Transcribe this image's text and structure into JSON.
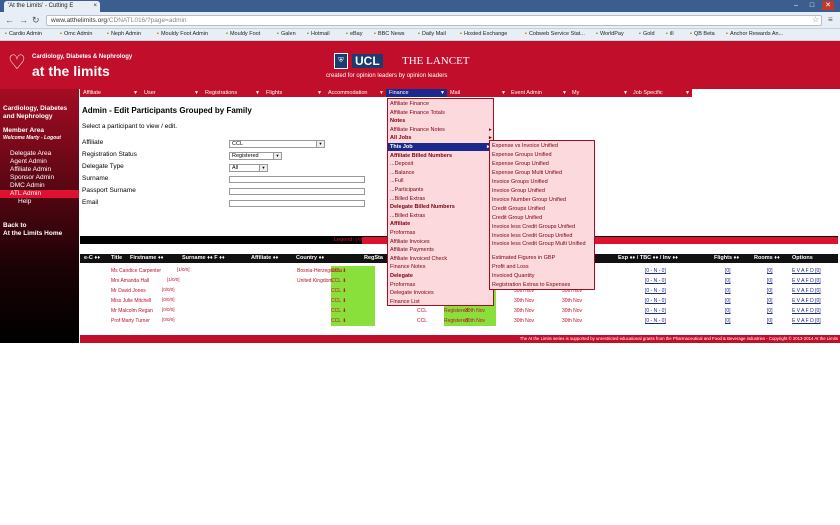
{
  "browser": {
    "tab_title": "'At the Limits' - Cutting E",
    "url_host": "www.atthelimits.org",
    "url_path": "/CDNATL016/?page=admin",
    "bookmarks": [
      "Cardio Admin",
      "Omc Admin",
      "Neph Admin",
      "Mouldy Foot Admin",
      "Mouldy Foot",
      "Galen",
      "Hotmail",
      "eBay",
      "BBC News",
      "Daily Mail",
      "Hosted Exchange",
      "Cobweb Service Stat...",
      "WorldPay",
      "Gold",
      "ill",
      "QB Beta",
      "Anchor Rewards An..."
    ]
  },
  "brand": {
    "logo_line1": "Cardiology, Diabetes & Nephrology",
    "logo_line2": "at the limits",
    "ucl": "UCL",
    "lancet": "THE LANCET",
    "tagline": "created for opinion leaders by opinion leaders"
  },
  "sidebar": {
    "heading1": "Cardiology, Diabetes",
    "heading2": "and Nephrology",
    "member_area": "Member Area",
    "welcome": "Welcome Marty - Logout",
    "items": [
      "Delegate Area",
      "Agent Admin",
      "Affiliate Admin",
      "Sponsor Admin",
      "DMC Admin",
      "ATL Admin",
      "Help"
    ],
    "back1": "Back to",
    "back2": "At the Limits Home"
  },
  "topnav": [
    "Affiliate",
    "User",
    "Registrations",
    "Flights",
    "Accommodation",
    "Finance",
    "Mail",
    "Event Admin",
    "My",
    "Job Specific"
  ],
  "page": {
    "title": "Admin - Edit Participants Grouped by Family",
    "instruction": "Select a participant to view / edit."
  },
  "form": {
    "affiliate_label": "Affiliate",
    "affiliate_value": "CCL",
    "reg_status_label": "Registration Status",
    "reg_status_value": "Registered",
    "delegate_type_label": "Delegate Type",
    "delegate_type_value": "All",
    "surname_label": "Surname",
    "passport_label": "Passport Surname",
    "email_label": "Email"
  },
  "legend": "Legend:  (<num",
  "table": {
    "headers": [
      "e-C",
      "Title",
      "Firstname",
      "Surname",
      "F",
      "Affiliate",
      "Country",
      "RegSta",
      "Exp",
      "TBC",
      "Inv",
      "Flights",
      "Rooms",
      "Options"
    ],
    "rows": [
      {
        "name": "Ms Candice Carpenter",
        "counts": "[1/0/0]",
        "affiliate": "CCL",
        "country": "Bosnia-Herzegovina",
        "reg": "Registered",
        "code": "",
        "d1": "",
        "d2": "",
        "fin": "[0 - N - 0]",
        "flights": "[0]",
        "rooms": "[0]",
        "opts": "E V A F D [0]"
      },
      {
        "name": "Mrs Amanda Hall",
        "counts": "[1/0/0]",
        "affiliate": "CCL",
        "country": "United Kingdom",
        "reg": "Registered",
        "code": "",
        "d1": "",
        "d2": "",
        "fin": "[0 - N - 0]",
        "flights": "[0]",
        "rooms": "[0]",
        "opts": "E V A F D [0]"
      },
      {
        "name": "Mr David Jones",
        "counts": "[0/0/0]",
        "affiliate": "CCL",
        "country": "",
        "reg": "Registered",
        "code": "",
        "d1": "",
        "d2": "30th Nov",
        "fin": "[0 - N - 0]",
        "flights": "[0]",
        "rooms": "[0]",
        "opts": "E V A F D [0]"
      },
      {
        "name": "Miss Julie Mitchell",
        "counts": "[0/0/0]",
        "affiliate": "CCL",
        "country": "",
        "reg": "Registered",
        "code": "",
        "d1": "",
        "d2": "30th Nov",
        "fin": "[0 - N - 0]",
        "flights": "[0]",
        "rooms": "[0]",
        "opts": "E V A F D [0]"
      },
      {
        "name": "Mr Malcolm Regan",
        "counts": "[0/0/0]",
        "affiliate": "CCL",
        "country": "",
        "reg": "Registered",
        "code": "CCL",
        "d1": "30th Nov",
        "d2": "30th Nov",
        "fin": "[0 - N - 0]",
        "flights": "[0]",
        "rooms": "[0]",
        "opts": "E V A F D [0]"
      },
      {
        "name": "Prof Marty Turner",
        "counts": "[0/0/0]",
        "affiliate": "CCL",
        "country": "",
        "reg": "Registered",
        "code": "CCL",
        "d1": "30th Nov",
        "d2": "30th Nov",
        "fin": "[0 - N - 0]",
        "flights": "[0]",
        "rooms": "[0]",
        "opts": "E V A F D [0]"
      }
    ]
  },
  "finance_menu": [
    {
      "label": "Affiliate Finance",
      "type": "item"
    },
    {
      "label": "Affiliate Finance Totals",
      "type": "item"
    },
    {
      "label": "Notes",
      "type": "head"
    },
    {
      "label": "Affiliate Finance Notes",
      "type": "item",
      "sub": true
    },
    {
      "label": "All Jobs",
      "type": "head",
      "sub": true
    },
    {
      "label": "This Job",
      "type": "active",
      "sub": true
    },
    {
      "label": "Affiliate Billed Numbers",
      "type": "head"
    },
    {
      "label": "...Deposit",
      "type": "item"
    },
    {
      "label": "...Balance",
      "type": "item"
    },
    {
      "label": "...Full",
      "type": "item"
    },
    {
      "label": "...Participants",
      "type": "item"
    },
    {
      "label": "...Billed Extras",
      "type": "item"
    },
    {
      "label": "Delegate Billed Numbers",
      "type": "head"
    },
    {
      "label": "...Billed Extras",
      "type": "item"
    },
    {
      "label": "Affiliate",
      "type": "head"
    },
    {
      "label": "Proformas",
      "type": "item"
    },
    {
      "label": "Affiliate Invoices",
      "type": "item"
    },
    {
      "label": "Affiliate Payments",
      "type": "item"
    },
    {
      "label": "Affiliate Invoiced Check",
      "type": "item"
    },
    {
      "label": "Finance Notes",
      "type": "item"
    },
    {
      "label": "Delegate",
      "type": "head"
    },
    {
      "label": "Proformas",
      "type": "item"
    },
    {
      "label": "Delegate Invoices",
      "type": "item"
    },
    {
      "label": "Finance List",
      "type": "item"
    }
  ],
  "this_job_menu": [
    "Expense vs Invoice Unified",
    "Expense Groups Unified",
    "Expense Group Unified",
    "Expense Group Multi Unified",
    "Invoice Groups Unified",
    "Invoice Group Unified",
    "Invoice Number Group Unified",
    "Credit Groups Unified",
    "Credit Group Unified",
    "Invoice less Credit Groups Unified",
    "Invoice less Credit Group Unified",
    "Invoice less Credit Group Multi Unified",
    "Estimated Figures in GBP",
    "Profit and Loss",
    "Invoiced Quantity",
    "Registration Extras to Expenses"
  ],
  "footer": "The At the Limits series is supported by unrestricted educational grants from the Pharmaceutical and Food & Beverage industries - Copyright © 2013-2014 At the Limits"
}
